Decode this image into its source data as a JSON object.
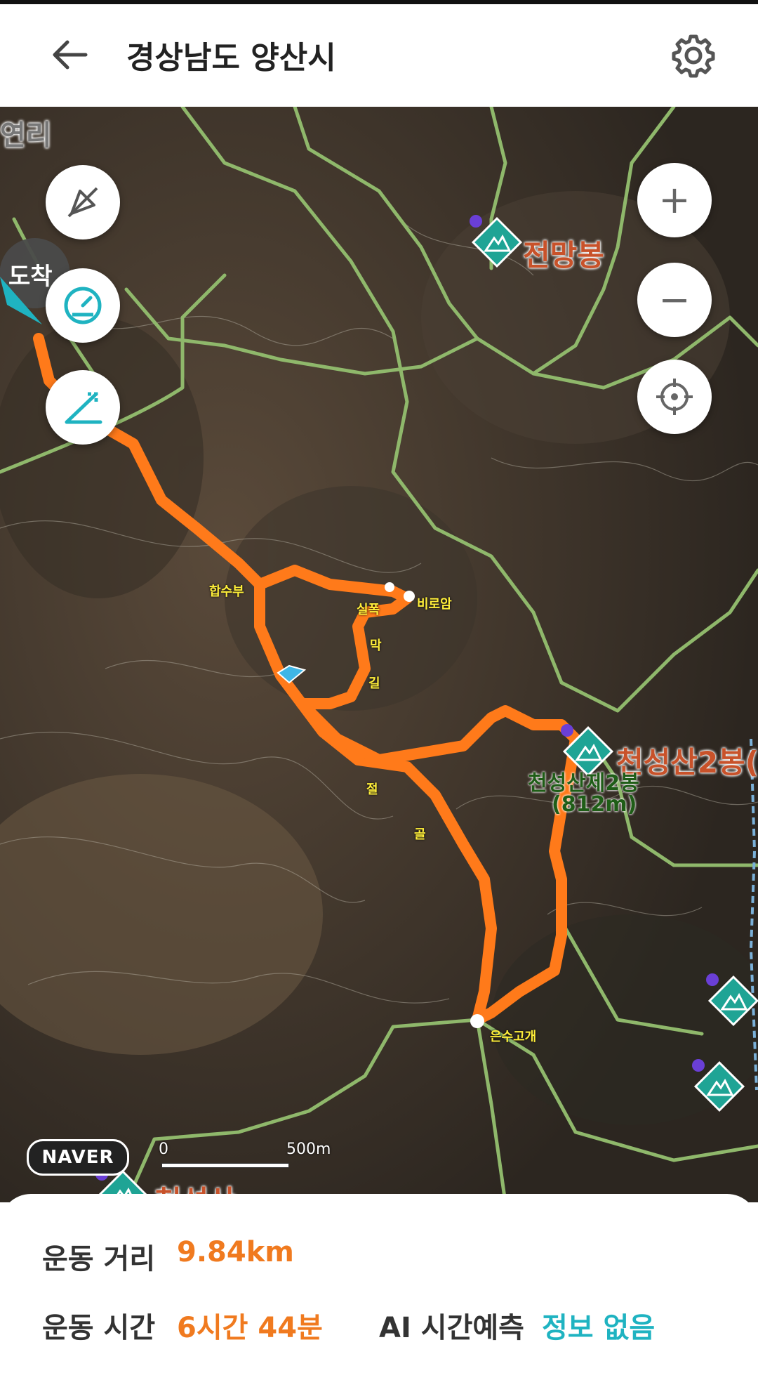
{
  "header": {
    "title": "경상남도 양산시"
  },
  "map": {
    "marker_arrival": "도착",
    "place_labels": {
      "top_left": "연리",
      "junction": "합수부",
      "waterfall": "실폭",
      "temple": "비로암",
      "trail_mak": "막",
      "trail_gil": "길",
      "valley_jeol": "절",
      "valley_gol": "골",
      "pass": "은수고개"
    },
    "peaks": {
      "jeonmangbong": "전망봉",
      "cheonseong2": "천성산2봉(",
      "cheonseong2_green_line1": "천성산제2봉",
      "cheonseong2_green_line2": "(812m)",
      "cheonseongsan": "천성산"
    },
    "scale": {
      "start": "0",
      "end": "500m"
    },
    "brand": "NAVER",
    "controls": {
      "zoom_in": "+",
      "zoom_out": "−"
    },
    "colors": {
      "route": "#ff7a1a",
      "trail": "#8fb86b",
      "poi": "#1fa495"
    }
  },
  "stats": {
    "distance_label": "운동 거리",
    "distance_value": "9.84km",
    "time_label": "운동 시간",
    "time_value": "6시간 44분",
    "ai_label": "AI 시간예측",
    "ai_value": "정보 없음"
  }
}
